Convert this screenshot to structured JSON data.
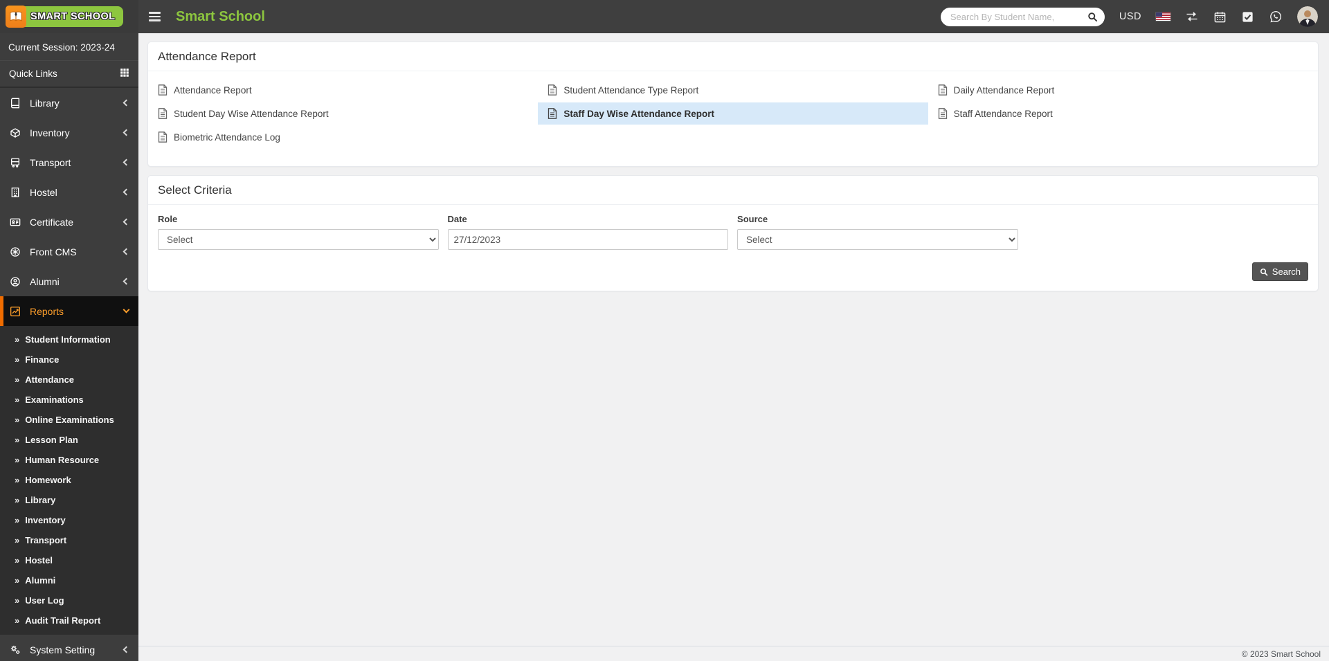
{
  "colors": {
    "accent_green": "#8dc63f",
    "accent_orange": "#ef6c00",
    "active_link_bg": "#d7e9f9",
    "header_bg": "#3f3f3f",
    "sidebar_bg": "#3d3d3d",
    "submenu_bg": "#2e2e2e"
  },
  "header": {
    "logo_text": "SMART SCHOOL",
    "title": "Smart School",
    "search_placeholder": "Search By Student Name,",
    "currency": "USD",
    "icon_names": [
      "search-icon",
      "us-flag-icon",
      "swap-arrows-icon",
      "calendar-icon",
      "check-square-icon",
      "whatsapp-icon",
      "user-avatar"
    ]
  },
  "sidebar": {
    "session_label": "Current Session: 2023-24",
    "quick_links_label": "Quick Links",
    "menu": [
      {
        "label": "Library",
        "icon": "book-icon"
      },
      {
        "label": "Inventory",
        "icon": "box-icon"
      },
      {
        "label": "Transport",
        "icon": "bus-icon"
      },
      {
        "label": "Hostel",
        "icon": "building-icon"
      },
      {
        "label": "Certificate",
        "icon": "id-card-icon"
      },
      {
        "label": "Front CMS",
        "icon": "globe-icon"
      },
      {
        "label": "Alumni",
        "icon": "user-circle-icon"
      }
    ],
    "reports": {
      "label": "Reports",
      "icon": "chart-line-icon",
      "expanded": true
    },
    "submenu": [
      "Student Information",
      "Finance",
      "Attendance",
      "Examinations",
      "Online Examinations",
      "Lesson Plan",
      "Human Resource",
      "Homework",
      "Library",
      "Inventory",
      "Transport",
      "Hostel",
      "Alumni",
      "User Log",
      "Audit Trail Report"
    ],
    "system_setting_label": "System Setting"
  },
  "main": {
    "report_card": {
      "title": "Attendance Report",
      "links": [
        {
          "label": "Attendance Report",
          "active": false
        },
        {
          "label": "Student Attendance Type Report",
          "active": false
        },
        {
          "label": "Daily Attendance Report",
          "active": false
        },
        {
          "label": "Student Day Wise Attendance Report",
          "active": false
        },
        {
          "label": "Staff Day Wise Attendance Report",
          "active": true
        },
        {
          "label": "Staff Attendance Report",
          "active": false
        },
        {
          "label": "Biometric Attendance Log",
          "active": false
        }
      ]
    },
    "criteria_card": {
      "title": "Select Criteria",
      "fields": {
        "role": {
          "label": "Role",
          "value": "Select"
        },
        "date": {
          "label": "Date",
          "value": "27/12/2023"
        },
        "source": {
          "label": "Source",
          "value": "Select"
        }
      },
      "search_button_label": "Search"
    }
  },
  "footer": {
    "copyright": "© 2023 Smart School"
  }
}
